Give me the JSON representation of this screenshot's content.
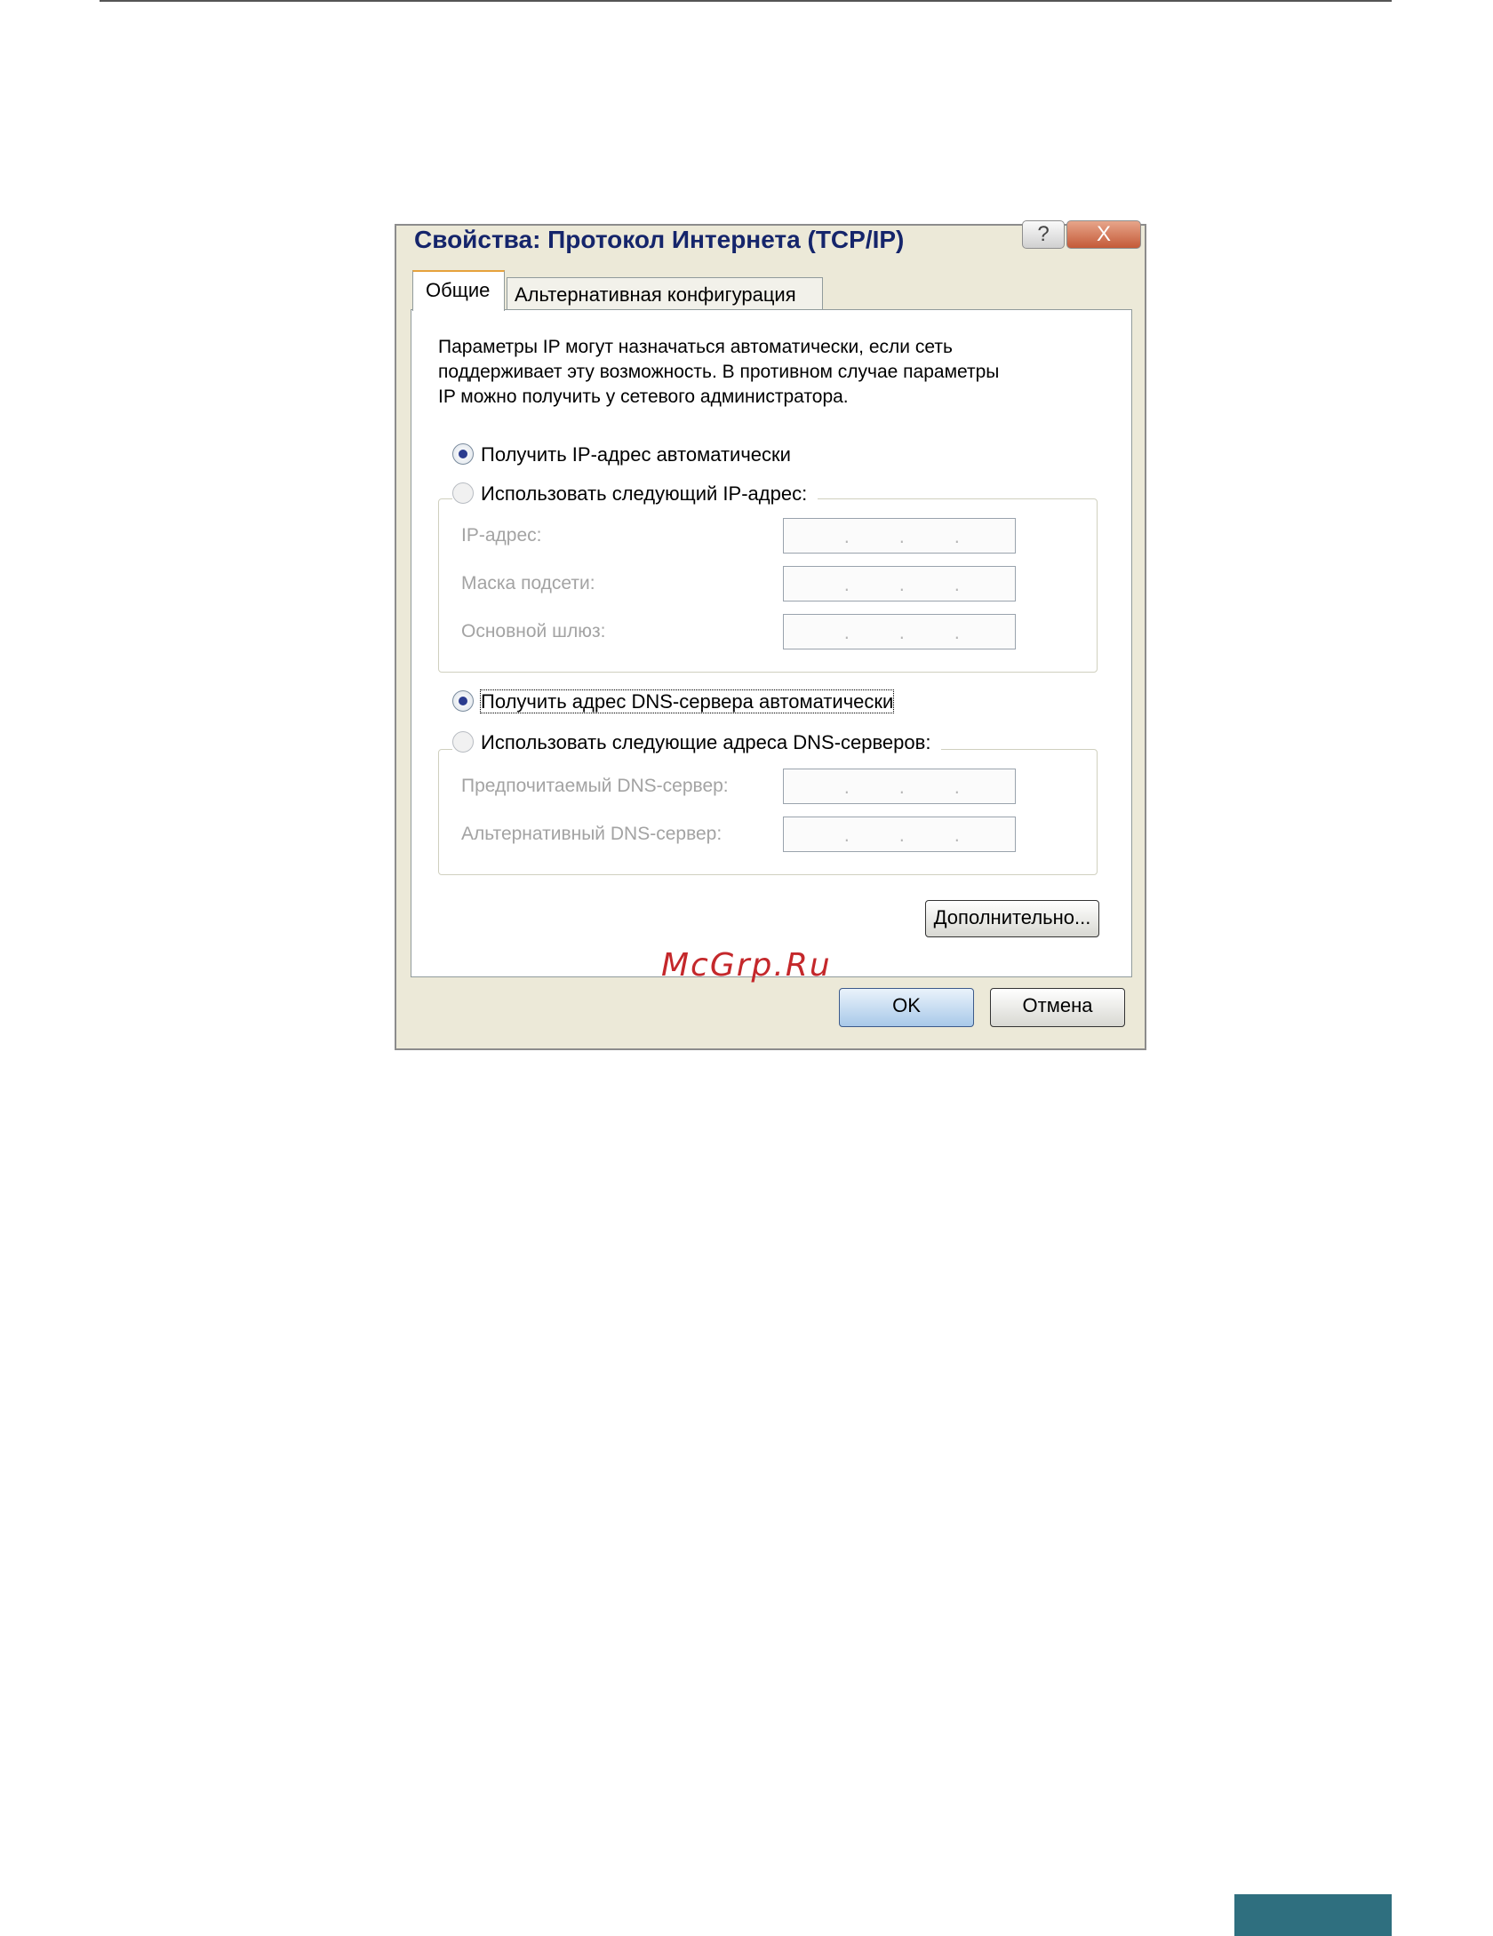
{
  "dialog": {
    "title": "Свойства: Протокол Интернета (TCP/IP)",
    "help_button": "?",
    "close_button": "X"
  },
  "tabs": [
    {
      "label": "Общие",
      "active": true
    },
    {
      "label": "Альтернативная конфигурация",
      "active": false
    }
  ],
  "intro_lines": [
    "Параметры IP могут назначаться автоматически, если сеть",
    "поддерживает эту возможность. В противном случае параметры",
    "IP можно получить у сетевого администратора."
  ],
  "ip_section": {
    "auto_option": "Получить IP-адрес автоматически",
    "manual_option": "Использовать следующий IP-адрес:",
    "selected": "auto",
    "fields": [
      {
        "label": "IP-адрес:",
        "value": " .   .   . "
      },
      {
        "label": "Маска подсети:",
        "value": " .   .   . "
      },
      {
        "label": "Основной шлюз:",
        "value": " .   .   . "
      }
    ]
  },
  "dns_section": {
    "auto_option": "Получить адрес DNS-сервера автоматически",
    "manual_option": "Использовать следующие адреса DNS-серверов:",
    "selected": "auto",
    "fields": [
      {
        "label": "Предпочитаемый DNS-сервер:",
        "value": " .   .   . "
      },
      {
        "label": "Альтернативный DNS-сервер:",
        "value": " .   .   . "
      }
    ]
  },
  "buttons": {
    "advanced": "Дополнительно...",
    "ok": "OK",
    "cancel": "Отмена"
  },
  "watermark": "McGrp.Ru",
  "colors": {
    "title_text": "#15256b",
    "dialog_bg": "#ece9d8",
    "close_button": "#c45a38",
    "footer_bar": "#2f6f7f",
    "watermark": "#c4282b"
  }
}
